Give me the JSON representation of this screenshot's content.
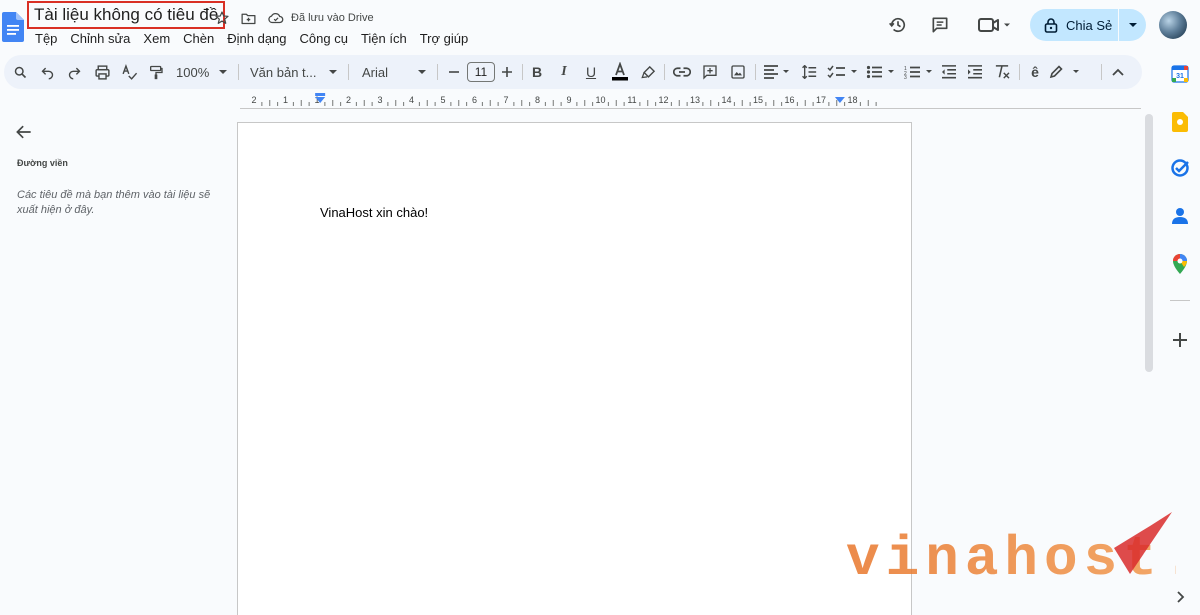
{
  "document": {
    "title": "Tài liệu không có tiêu đề",
    "save_status": "Đã lưu vào Drive",
    "body_text": "VinaHost xin chào!"
  },
  "menu": [
    "Tệp",
    "Chỉnh sửa",
    "Xem",
    "Chèn",
    "Định dạng",
    "Công cụ",
    "Tiện ích",
    "Trợ giúp"
  ],
  "header_actions": {
    "share_label": "Chia Sẻ",
    "icons": [
      "history-icon",
      "comment-icon",
      "meet-icon",
      "lock-icon",
      "avatar"
    ]
  },
  "toolbar": {
    "zoom": "100%",
    "style": "Văn bản t...",
    "font": "Arial",
    "font_size": "11",
    "icons": [
      "search-icon",
      "undo-icon",
      "redo-icon",
      "print-icon",
      "spellcheck-icon",
      "paint-format-icon",
      "bold-icon",
      "italic-icon",
      "underline-icon",
      "text-color-icon",
      "highlight-icon",
      "link-icon",
      "comment-add-icon",
      "image-icon",
      "align-icon",
      "line-spacing-icon",
      "checklist-icon",
      "bullet-list-icon",
      "numbered-list-icon",
      "outdent-icon",
      "indent-icon",
      "clear-format-icon",
      "input-tools-icon",
      "edit-mode-icon",
      "collapse-icon"
    ]
  },
  "ruler": {
    "labels": [
      "2",
      "1",
      "1",
      "2",
      "3",
      "4",
      "5",
      "6",
      "7",
      "8",
      "9",
      "10",
      "11",
      "12",
      "13",
      "14",
      "15",
      "16",
      "17",
      "18"
    ]
  },
  "outline": {
    "title": "Đường viền",
    "empty_message": "Các tiêu đề mà bạn thêm vào tài liệu sẽ xuất hiện ở đây."
  },
  "side_panel": {
    "icons": [
      "calendar-icon",
      "keep-icon",
      "tasks-icon",
      "contacts-icon",
      "maps-icon",
      "add-icon",
      "expand-icon"
    ]
  },
  "watermark": {
    "text": "vinahost."
  },
  "colors": {
    "accent": "#c2e7ff",
    "title_highlight": "#d93025",
    "toolbar_bg": "#edf2fa",
    "watermark_orange": "#e8762b",
    "watermark_red": "#d92b2b"
  }
}
